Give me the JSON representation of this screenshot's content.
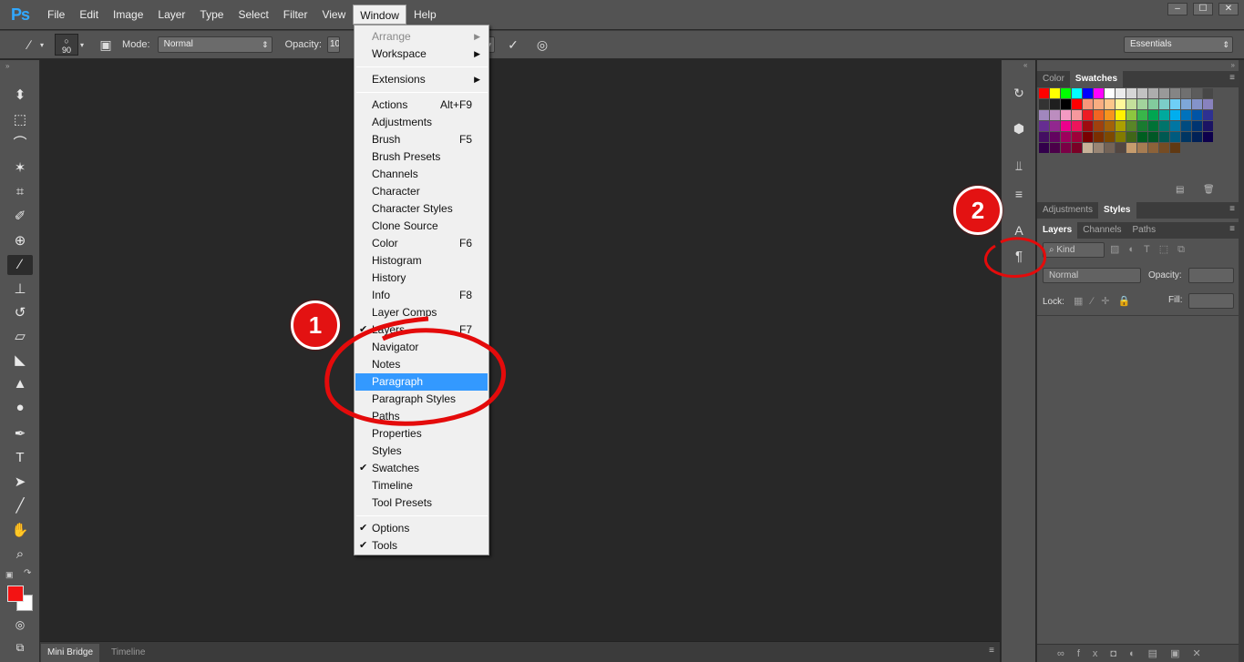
{
  "app": {
    "logo": "Ps"
  },
  "menubar": {
    "items": [
      "File",
      "Edit",
      "Image",
      "Layer",
      "Type",
      "Select",
      "Filter",
      "View",
      "Window",
      "Help"
    ]
  },
  "window_controls": [
    "–",
    "☐",
    "✕"
  ],
  "options_bar": {
    "brush_size": "90",
    "mode_label": "Mode:",
    "mode_value": "Normal",
    "opacity_label": "Opacity:",
    "opacity_value": "10",
    "workspace": "Essentials"
  },
  "window_menu": {
    "top": [
      {
        "label": "Arrange",
        "disabled": true,
        "submenu": true
      },
      {
        "label": "Workspace",
        "submenu": true
      }
    ],
    "extensions": {
      "label": "Extensions",
      "submenu": true
    },
    "items": [
      {
        "label": "Actions",
        "shortcut": "Alt+F9"
      },
      {
        "label": "Adjustments"
      },
      {
        "label": "Brush",
        "shortcut": "F5"
      },
      {
        "label": "Brush Presets"
      },
      {
        "label": "Channels"
      },
      {
        "label": "Character"
      },
      {
        "label": "Character Styles"
      },
      {
        "label": "Clone Source"
      },
      {
        "label": "Color",
        "shortcut": "F6"
      },
      {
        "label": "Histogram"
      },
      {
        "label": "History"
      },
      {
        "label": "Info",
        "shortcut": "F8"
      },
      {
        "label": "Layer Comps"
      },
      {
        "label": "Layers",
        "shortcut": "F7",
        "checked": true
      },
      {
        "label": "Navigator"
      },
      {
        "label": "Notes"
      },
      {
        "label": "Paragraph",
        "highlighted": true
      },
      {
        "label": "Paragraph Styles"
      },
      {
        "label": "Paths"
      },
      {
        "label": "Properties"
      },
      {
        "label": "Styles"
      },
      {
        "label": "Swatches",
        "checked": true
      },
      {
        "label": "Timeline"
      },
      {
        "label": "Tool Presets"
      }
    ],
    "bottom": [
      {
        "label": "Options",
        "checked": true
      },
      {
        "label": "Tools",
        "checked": true
      }
    ]
  },
  "panels": {
    "color_tabs": [
      "Color",
      "Swatches"
    ],
    "adjust_tabs": [
      "Adjustments",
      "Styles"
    ],
    "layer_tabs": [
      "Layers",
      "Channels",
      "Paths"
    ],
    "kind_label": "Kind",
    "blend_mode": "Normal",
    "opacity_label": "Opacity:",
    "lock_label": "Lock:",
    "fill_label": "Fill:"
  },
  "bottom_tabs": [
    "Mini Bridge",
    "Timeline"
  ],
  "annotations": {
    "one": "1",
    "two": "2"
  },
  "swatch_colors": [
    "#ff0000",
    "#ffff00",
    "#00ff00",
    "#00ffff",
    "#0000ff",
    "#ff00ff",
    "#ffffff",
    "#ebebeb",
    "#d6d6d6",
    "#c2c2c2",
    "#adadad",
    "#999999",
    "#858585",
    "#707070",
    "#5c5c5c",
    "#474747",
    "#333333",
    "#1f1f1f",
    "#000000",
    "#ff0000",
    "#f7977a",
    "#f9ad81",
    "#fdc68a",
    "#fff79a",
    "#c4df9b",
    "#a2d39c",
    "#82ca9d",
    "#7bcdc8",
    "#6ecff6",
    "#7ea7d8",
    "#8493ca",
    "#8882be",
    "#a187be",
    "#bc8dbf",
    "#f49ac2",
    "#f6989d",
    "#ed1c24",
    "#f26522",
    "#f7941d",
    "#fff200",
    "#8dc63f",
    "#39b54a",
    "#00a651",
    "#00a99d",
    "#00aeef",
    "#0072bc",
    "#0054a6",
    "#2e3192",
    "#662d91",
    "#92278f",
    "#ec008c",
    "#ed145b",
    "#9e0b0f",
    "#a0410d",
    "#a36209",
    "#aba000",
    "#598527",
    "#197b30",
    "#007236",
    "#00746b",
    "#0076a3",
    "#004b80",
    "#003471",
    "#1b1464",
    "#440e62",
    "#630460",
    "#9e005d",
    "#9e0039",
    "#790000",
    "#7b2e00",
    "#7d4900",
    "#827b00",
    "#406618",
    "#005e20",
    "#005826",
    "#005952",
    "#005b7f",
    "#003663",
    "#002157",
    "#0d004c",
    "#32004b",
    "#4b0049",
    "#7b0046",
    "#7a0026",
    "#c7b299",
    "#998675",
    "#736357",
    "#534741",
    "#c69c6d",
    "#a67c52",
    "#8c6239",
    "#754c24",
    "#603913"
  ]
}
